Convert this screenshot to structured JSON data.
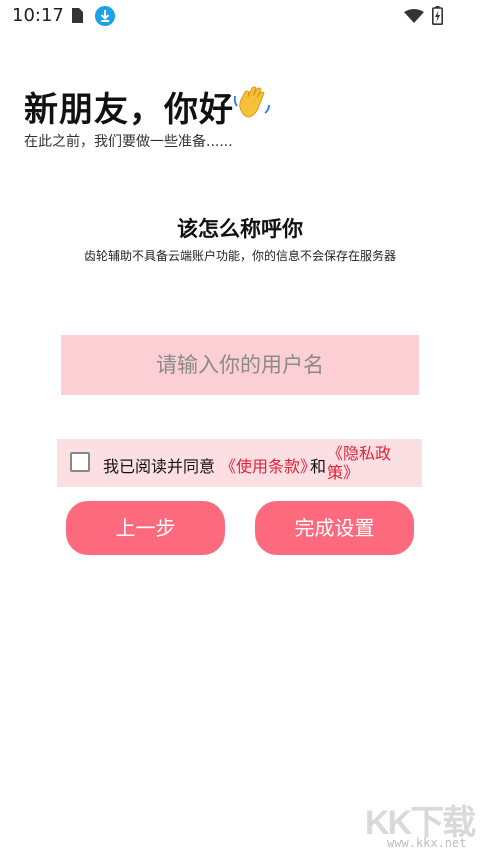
{
  "status_bar": {
    "time": "10:17",
    "icons": [
      "sim-card-icon",
      "download-icon",
      "wifi-icon",
      "battery-charging-icon"
    ]
  },
  "header": {
    "greeting": "新朋友，你好",
    "greeting_icon": "waving-hand-icon",
    "subtext": "在此之前，我们要做一些准备......"
  },
  "name_section": {
    "title": "该怎么称呼你",
    "description": "齿轮辅助不具备云端账户功能，你的信息不会保存在服务器",
    "username_placeholder": "请输入你的用户名",
    "username_value": ""
  },
  "agreement": {
    "checked": false,
    "prefix": "我已阅读并同意",
    "terms_link": "《使用条款》",
    "conjunction": "和",
    "privacy_link": "《隐私政策》"
  },
  "buttons": {
    "prev_label": "上一步",
    "finish_label": "完成设置"
  },
  "watermark": {
    "logo": "KK下载",
    "url": "www.kkx.net"
  },
  "colors": {
    "accent": "#fe6a7d",
    "input_bg": "#fbcfd4",
    "agree_bg": "#fcdfe3",
    "link": "#e0233a",
    "status_download": "#1aa3e8"
  }
}
